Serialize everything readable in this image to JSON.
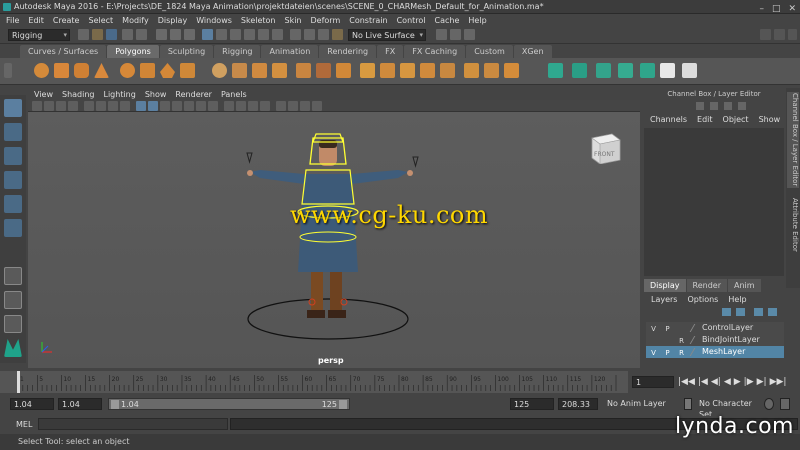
{
  "window": {
    "title": "Autodesk Maya 2016 - E:\\Projects\\DE_1824 Maya Animation\\projektdateien\\scenes\\SCENE_0_CHARMesh_Default_for_Animation.ma*",
    "minimize": "–",
    "maximize": "□",
    "close": "✕"
  },
  "menubar": [
    "File",
    "Edit",
    "Create",
    "Select",
    "Modify",
    "Display",
    "Windows",
    "Skeleton",
    "Skin",
    "Deform",
    "Constrain",
    "Control",
    "Cache",
    "Help"
  ],
  "status_line": {
    "mode_menu": "Rigging",
    "live_surface": "No Live Surface"
  },
  "shelf_tabs": [
    {
      "label": "Curves / Surfaces",
      "active": false
    },
    {
      "label": "Polygons",
      "active": true
    },
    {
      "label": "Sculpting",
      "active": false
    },
    {
      "label": "Rigging",
      "active": false
    },
    {
      "label": "Animation",
      "active": false
    },
    {
      "label": "Rendering",
      "active": false
    },
    {
      "label": "FX",
      "active": false
    },
    {
      "label": "FX Caching",
      "active": false
    },
    {
      "label": "Custom",
      "active": false
    },
    {
      "label": "XGen",
      "active": false
    }
  ],
  "viewport": {
    "menu": [
      "View",
      "Shading",
      "Lighting",
      "Show",
      "Renderer",
      "Panels"
    ],
    "camera_label": "persp",
    "viewcube_face": "FRONT",
    "watermark": "www.cg-ku.com"
  },
  "channel_box": {
    "header": "Channel Box / Layer Editor",
    "menu": [
      "Channels",
      "Edit",
      "Object",
      "Show"
    ]
  },
  "layer_editor": {
    "tabs": [
      {
        "label": "Display",
        "active": true
      },
      {
        "label": "Render",
        "active": false
      },
      {
        "label": "Anim",
        "active": false
      }
    ],
    "menu": [
      "Layers",
      "Options",
      "Help"
    ],
    "layers": [
      {
        "v": "V",
        "p": "P",
        "r": "",
        "name": "ControlLayer",
        "selected": false
      },
      {
        "v": "",
        "p": "",
        "r": "R",
        "name": "BindJointLayer",
        "selected": false
      },
      {
        "v": "V",
        "p": "P",
        "r": "R",
        "name": "MeshLayer",
        "selected": true
      }
    ]
  },
  "side_tabs": [
    "Channel Box / Layer Editor",
    "Attribute Editor"
  ],
  "timeline": {
    "ticks": [
      "1",
      "5",
      "10",
      "15",
      "20",
      "25",
      "30",
      "35",
      "40",
      "45",
      "50",
      "55",
      "60",
      "65",
      "70",
      "75",
      "80",
      "85",
      "90",
      "95",
      "100",
      "105",
      "110",
      "115",
      "120"
    ],
    "current_frame": "1"
  },
  "playback": [
    "|◀◀",
    "|◀",
    "◀|",
    "◀",
    "▶",
    "|▶",
    "▶|",
    "▶▶|"
  ],
  "range": {
    "start": "1.04",
    "playback_start": "1.04",
    "slider_start": "1.04",
    "slider_end": "125",
    "playback_end": "125",
    "end": "208.33",
    "anim_layer": "No Anim Layer",
    "character_set": "No Character Set"
  },
  "command_line": {
    "language": "MEL"
  },
  "help_line": "Select Tool: select an object",
  "brand": "lynda.com"
}
